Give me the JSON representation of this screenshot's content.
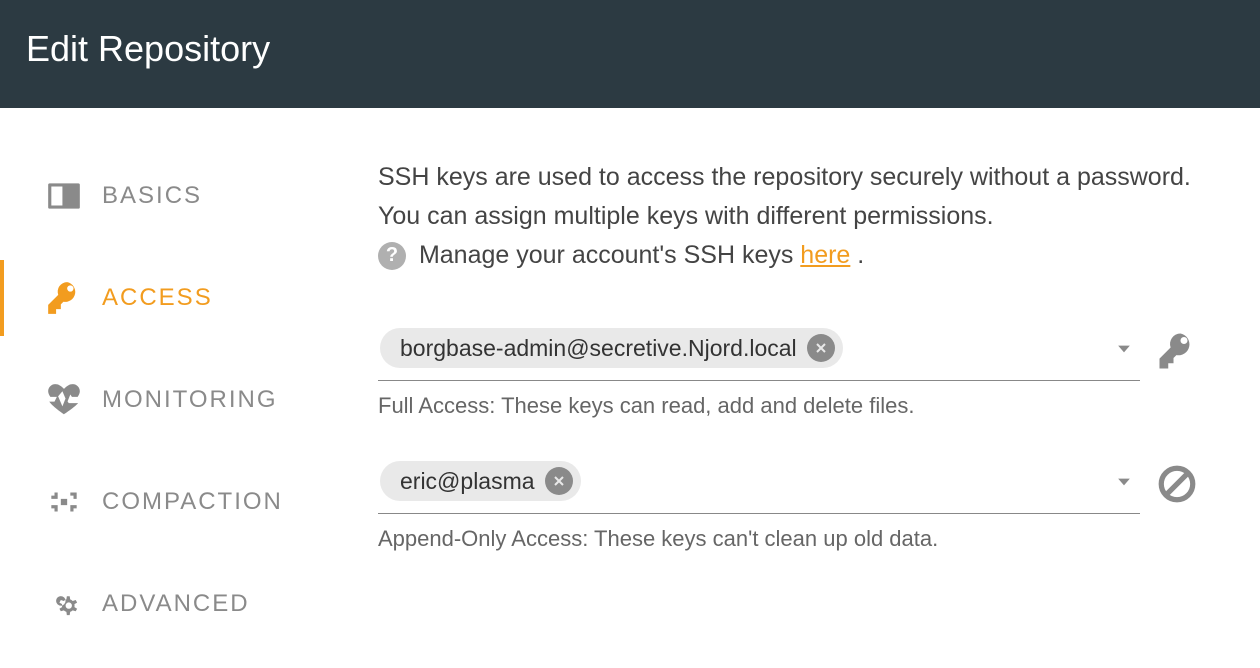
{
  "header": {
    "title": "Edit Repository"
  },
  "sidebar": {
    "items": [
      {
        "label": "Basics"
      },
      {
        "label": "Access"
      },
      {
        "label": "Monitoring"
      },
      {
        "label": "Compaction"
      },
      {
        "label": "Advanced"
      }
    ],
    "activeIndex": 1
  },
  "intro": {
    "text": "SSH keys are used to access the repository securely without a password. You can assign multiple keys with different permissions.",
    "manage_prefix": " Manage your account's SSH keys ",
    "link_label": "here",
    "suffix": " ."
  },
  "fullAccess": {
    "chip": "borgbase-admin@secretive.Njord.local",
    "helper": "Full Access: These keys can read, add and delete files."
  },
  "appendOnly": {
    "chip": "eric@plasma",
    "helper": "Append-Only Access: These keys can't clean up old data."
  }
}
